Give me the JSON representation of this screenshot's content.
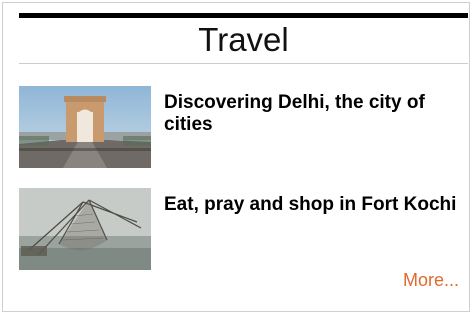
{
  "section": {
    "title": "Travel"
  },
  "articles": [
    {
      "headline": "Discovering Delhi, the city of cities",
      "image": "india-gate-photo"
    },
    {
      "headline": "Eat, pray and shop in Fort Kochi",
      "image": "chinese-fishing-net-photo"
    }
  ],
  "more_link": "More...",
  "colors": {
    "link": "#e06a2c",
    "headline": "#000000",
    "top_rule": "#000000",
    "divider": "#cccccc"
  }
}
